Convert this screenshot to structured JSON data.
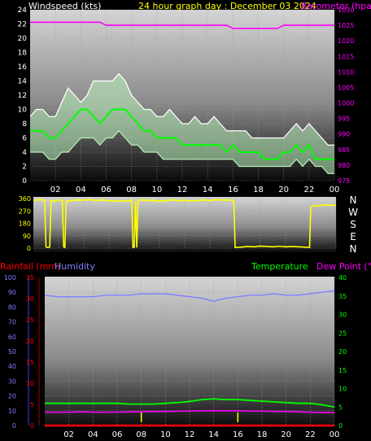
{
  "colors": {
    "speed": "#ffffff",
    "gust_band": "#b8f0b8",
    "avg": "#00ff00",
    "barometer": "#ff00ff",
    "direction": "#ffff00",
    "rainfall": "#ff0000",
    "humidity": "#7f7fff",
    "temperature": "#00ff00",
    "dewpoint": "#ff00ff",
    "axis_text": "#ffffff"
  },
  "chart_data": [
    {
      "type": "line",
      "title": "24 hour graph day : December 03 2024",
      "ylabel": "Windspeed (kts)",
      "y2label": "Barometer (hpa)",
      "ylim": [
        0,
        24
      ],
      "y2lim": [
        975,
        1030
      ],
      "yticks": [
        "0",
        "2",
        "4",
        "6",
        "8",
        "10",
        "12",
        "14",
        "16",
        "18",
        "20",
        "22",
        "24"
      ],
      "y2ticks": [
        "975",
        "980",
        "985",
        "990",
        "995",
        "1000",
        "1005",
        "1010",
        "1015",
        "1020",
        "1025",
        "1030"
      ],
      "xticks": [
        "02",
        "04",
        "06",
        "08",
        "10",
        "12",
        "14",
        "16",
        "18",
        "20",
        "22",
        "00"
      ],
      "grid": true,
      "x": [
        0,
        0.5,
        1,
        1.5,
        2,
        2.5,
        3,
        3.5,
        4,
        4.5,
        5,
        5.5,
        6,
        6.5,
        7,
        7.5,
        8,
        8.5,
        9,
        9.5,
        10,
        10.5,
        11,
        11.5,
        12,
        12.5,
        13,
        13.5,
        14,
        14.5,
        15,
        15.5,
        16,
        16.5,
        17,
        17.5,
        18,
        18.5,
        19,
        19.5,
        20,
        20.5,
        21,
        21.5,
        22,
        22.5,
        23,
        23.5,
        24
      ],
      "series": [
        {
          "key": "gust",
          "values": [
            9,
            10,
            10,
            9,
            9,
            11,
            13,
            12,
            11,
            12,
            14,
            14,
            14,
            14,
            15,
            14,
            12,
            11,
            10,
            10,
            9,
            9,
            10,
            9,
            8,
            8,
            9,
            8,
            8,
            9,
            8,
            7,
            7,
            7,
            7,
            6,
            6,
            6,
            6,
            6,
            6,
            7,
            8,
            7,
            8,
            7,
            6,
            5,
            5
          ]
        },
        {
          "key": "avg",
          "values": [
            7,
            7,
            7,
            6,
            6,
            7,
            8,
            9,
            10,
            10,
            9,
            8,
            9,
            10,
            10,
            10,
            9,
            8,
            7,
            7,
            6,
            6,
            6,
            6,
            5,
            5,
            5,
            5,
            5,
            5,
            5,
            4,
            5,
            4,
            4,
            4,
            4,
            3,
            3,
            3,
            4,
            4,
            5,
            4,
            5,
            3,
            3,
            3,
            3
          ]
        },
        {
          "key": "low",
          "values": [
            4,
            4,
            4,
            3,
            3,
            4,
            4,
            5,
            6,
            6,
            6,
            5,
            6,
            6,
            7,
            6,
            5,
            5,
            4,
            4,
            4,
            3,
            3,
            3,
            3,
            3,
            3,
            3,
            3,
            3,
            3,
            3,
            3,
            2,
            2,
            2,
            2,
            2,
            2,
            2,
            2,
            2,
            3,
            2,
            3,
            2,
            2,
            1,
            1
          ]
        },
        {
          "key": "barometer",
          "values": [
            1026,
            1026,
            1026,
            1026,
            1026,
            1026,
            1026,
            1026,
            1026,
            1026,
            1026,
            1026,
            1025,
            1025,
            1025,
            1025,
            1025,
            1025,
            1025,
            1025,
            1025,
            1025,
            1025,
            1025,
            1025,
            1025,
            1025,
            1025,
            1025,
            1025,
            1025,
            1025,
            1024,
            1024,
            1024,
            1024,
            1024,
            1024,
            1024,
            1024,
            1025,
            1025,
            1025,
            1025,
            1025,
            1025,
            1025,
            1025,
            1025
          ]
        }
      ]
    },
    {
      "type": "line",
      "ylim": [
        0,
        360
      ],
      "yticks": [
        "0",
        "90",
        "180",
        "270",
        "360"
      ],
      "compass": [
        "N",
        "W",
        "S",
        "E",
        "N"
      ],
      "xticks": [
        "02",
        "04",
        "06",
        "08",
        "10",
        "12",
        "14",
        "16",
        "18",
        "20",
        "22",
        "00"
      ],
      "grid": true,
      "series": [
        {
          "key": "direction",
          "points": [
            [
              0,
              345
            ],
            [
              0.3,
              350
            ],
            [
              0.5,
              352
            ],
            [
              0.9,
              348
            ],
            [
              1,
              10
            ],
            [
              1.1,
              5
            ],
            [
              1.3,
              8
            ],
            [
              1.4,
              345
            ],
            [
              1.7,
              342
            ],
            [
              2,
              350
            ],
            [
              2.3,
              345
            ],
            [
              2.4,
              10
            ],
            [
              2.5,
              5
            ],
            [
              2.6,
              340
            ],
            [
              3,
              345
            ],
            [
              3.5,
              350
            ],
            [
              4,
              348
            ],
            [
              4.5,
              352
            ],
            [
              5,
              345
            ],
            [
              5.5,
              350
            ],
            [
              6,
              345
            ],
            [
              6.5,
              340
            ],
            [
              7,
              345
            ],
            [
              7.5,
              342
            ],
            [
              7.8,
              350
            ],
            [
              7.9,
              5
            ],
            [
              8,
              8
            ],
            [
              8.1,
              340
            ],
            [
              8.2,
              5
            ],
            [
              8.3,
              345
            ],
            [
              8.7,
              350
            ],
            [
              9,
              345
            ],
            [
              9.5,
              348
            ],
            [
              10,
              340
            ],
            [
              10.5,
              345
            ],
            [
              11,
              350
            ],
            [
              11.5,
              345
            ],
            [
              12,
              348
            ],
            [
              12.5,
              342
            ],
            [
              13,
              345
            ],
            [
              13.5,
              350
            ],
            [
              14,
              345
            ],
            [
              14.5,
              352
            ],
            [
              15,
              348
            ],
            [
              15.5,
              350
            ],
            [
              15.9,
              345
            ],
            [
              16,
              5
            ],
            [
              16.5,
              8
            ],
            [
              17,
              12
            ],
            [
              17.5,
              10
            ],
            [
              18,
              15
            ],
            [
              18.5,
              12
            ],
            [
              19,
              10
            ],
            [
              19.5,
              14
            ],
            [
              20,
              10
            ],
            [
              20.5,
              12
            ],
            [
              21,
              10
            ],
            [
              21.5,
              8
            ],
            [
              21.9,
              5
            ],
            [
              22,
              300
            ],
            [
              22.3,
              310
            ],
            [
              22.7,
              305
            ],
            [
              23,
              315
            ],
            [
              23.5,
              310
            ],
            [
              24,
              312
            ]
          ]
        }
      ]
    },
    {
      "type": "line",
      "ylabel": "Rainfall (mm)",
      "ylabel2": "Humidity",
      "y2label": "Temperature",
      "y2label2": "Dew Point (°C)",
      "ylim_rain": [
        0,
        35
      ],
      "ylim_hum": [
        0,
        100
      ],
      "y2lim": [
        0,
        40
      ],
      "rain_ticks": [
        "0",
        "5",
        "10",
        "15",
        "20",
        "25",
        "30",
        "35"
      ],
      "hum_ticks": [
        "0",
        "10",
        "20",
        "30",
        "40",
        "50",
        "60",
        "70",
        "80",
        "90",
        "100"
      ],
      "temp_ticks": [
        "0",
        "5",
        "10",
        "15",
        "20",
        "25",
        "30",
        "35",
        "40"
      ],
      "xticks": [
        "02",
        "04",
        "06",
        "08",
        "10",
        "12",
        "14",
        "16",
        "18",
        "20",
        "22",
        "00"
      ],
      "grid": true,
      "x": [
        0,
        1,
        2,
        3,
        4,
        5,
        6,
        7,
        8,
        9,
        10,
        11,
        12,
        13,
        14,
        15,
        16,
        17,
        18,
        19,
        20,
        21,
        22,
        23,
        24
      ],
      "series": [
        {
          "key": "humidity",
          "values": [
            88,
            87,
            87,
            87,
            87,
            88,
            88,
            88,
            89,
            89,
            89,
            88,
            87,
            86,
            84,
            86,
            87,
            88,
            88,
            89,
            88,
            88,
            89,
            90,
            91
          ]
        },
        {
          "key": "temperature",
          "values": [
            6,
            6,
            6,
            6,
            6,
            6,
            6,
            5.8,
            5.8,
            5.8,
            6,
            6.2,
            6.5,
            7,
            7.2,
            7,
            7,
            6.8,
            6.6,
            6.4,
            6.2,
            6,
            6,
            5.6,
            5
          ]
        },
        {
          "key": "dewpoint",
          "values": [
            3.6,
            3.6,
            3.6,
            3.7,
            3.6,
            3.6,
            3.6,
            3.7,
            3.7,
            3.8,
            3.8,
            3.9,
            3.9,
            4,
            4,
            4,
            4,
            3.9,
            3.9,
            3.8,
            3.8,
            3.7,
            3.6,
            3.5,
            3.5
          ]
        },
        {
          "key": "rainfall",
          "values": [
            0,
            0,
            0,
            0,
            0,
            0,
            0,
            0,
            0,
            0,
            0,
            0,
            0,
            0,
            0,
            0,
            0,
            0,
            0,
            0,
            0,
            0,
            0,
            0,
            0
          ]
        }
      ]
    }
  ]
}
